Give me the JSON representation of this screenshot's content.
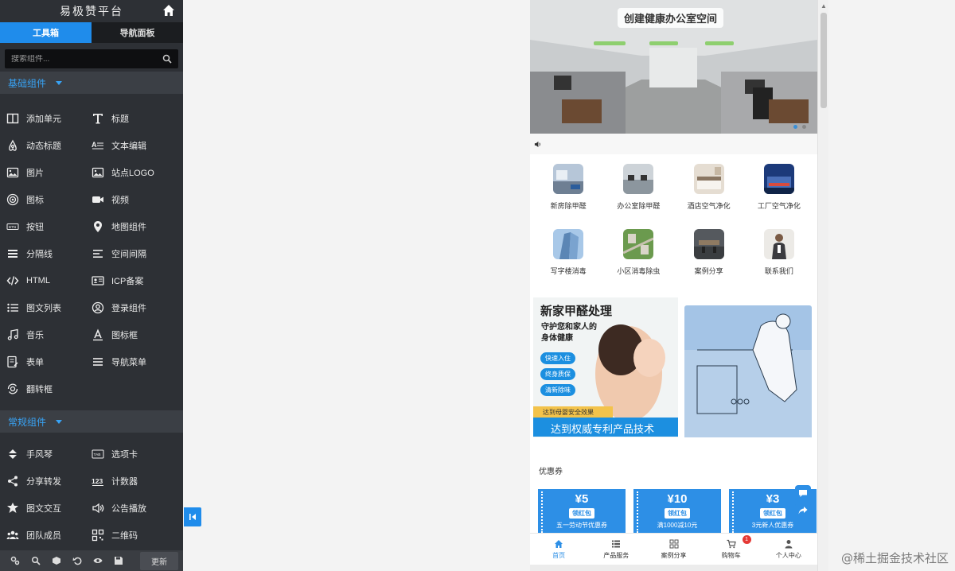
{
  "sidebar": {
    "title": "易极赞平台",
    "tabs": [
      "工具箱",
      "导航面板"
    ],
    "search_placeholder": "搜索组件...",
    "section1": "基础组件",
    "basic": [
      {
        "label": "添加单元",
        "icon": "columns-icon"
      },
      {
        "label": "标题",
        "icon": "title-icon"
      },
      {
        "label": "动态标题",
        "icon": "airbnb-icon"
      },
      {
        "label": "文本编辑",
        "icon": "text-edit-icon"
      },
      {
        "label": "图片",
        "icon": "image-icon"
      },
      {
        "label": "站点LOGO",
        "icon": "logo-icon"
      },
      {
        "label": "图标",
        "icon": "target-icon"
      },
      {
        "label": "视频",
        "icon": "video-icon"
      },
      {
        "label": "按钮",
        "icon": "button-icon"
      },
      {
        "label": "地图组件",
        "icon": "map-pin-icon"
      },
      {
        "label": "分隔线",
        "icon": "divider-icon"
      },
      {
        "label": "空间间隔",
        "icon": "spacing-icon"
      },
      {
        "label": "HTML",
        "icon": "code-icon"
      },
      {
        "label": "ICP备案",
        "icon": "id-card-icon"
      },
      {
        "label": "图文列表",
        "icon": "list-icon"
      },
      {
        "label": "登录组件",
        "icon": "user-circle-icon"
      },
      {
        "label": "音乐",
        "icon": "music-icon"
      },
      {
        "label": "图标框",
        "icon": "font-icon"
      },
      {
        "label": "表单",
        "icon": "form-icon"
      },
      {
        "label": "导航菜单",
        "icon": "menu-icon"
      },
      {
        "label": "翻转框",
        "icon": "flip-icon"
      }
    ],
    "section2": "常规组件",
    "common": [
      {
        "label": "手风琴",
        "icon": "accordion-icon"
      },
      {
        "label": "选项卡",
        "icon": "tab-icon"
      },
      {
        "label": "分享转发",
        "icon": "share-icon"
      },
      {
        "label": "计数器",
        "icon": "counter-icon"
      },
      {
        "label": "图文交互",
        "icon": "puzzle-icon"
      },
      {
        "label": "公告播放",
        "icon": "speaker-icon"
      },
      {
        "label": "团队成员",
        "icon": "team-icon"
      },
      {
        "label": "二维码",
        "icon": "qrcode-icon"
      }
    ],
    "update_label": "更新"
  },
  "phone": {
    "banner_title": "创建健康办公室空间",
    "services": [
      {
        "label": "新房除甲醛"
      },
      {
        "label": "办公室除甲醛"
      },
      {
        "label": "酒店空气净化"
      },
      {
        "label": "工厂空气净化"
      },
      {
        "label": "写字楼消毒"
      },
      {
        "label": "小区消毒除虫"
      },
      {
        "label": "案例分享"
      },
      {
        "label": "联系我们"
      }
    ],
    "promo": {
      "headline": "新家甲醛处理",
      "sub1": "守护您和家人的",
      "sub2": "身体健康",
      "tags": [
        "快速入住",
        "终身质保",
        "清新除味"
      ],
      "strip": "达到母婴安全效果",
      "footer": "达到权威专利产品技术"
    },
    "coupon_title": "优惠券",
    "coupons": [
      {
        "amount": "¥5",
        "button": "领红包",
        "desc": "五一劳动节优惠券"
      },
      {
        "amount": "¥10",
        "button": "领红包",
        "desc": "满1000减10元"
      },
      {
        "amount": "¥3",
        "button": "领红包",
        "desc": "3元新人优惠券"
      }
    ],
    "tabbar": [
      {
        "label": "首页"
      },
      {
        "label": "产品服务"
      },
      {
        "label": "案例分享"
      },
      {
        "label": "购物车"
      },
      {
        "label": "个人中心"
      }
    ],
    "cart_badge": "1"
  },
  "watermark": "@稀土掘金技术社区",
  "colors": {
    "accent": "#1f8ceb",
    "sidebar_bg": "#2d3035"
  }
}
